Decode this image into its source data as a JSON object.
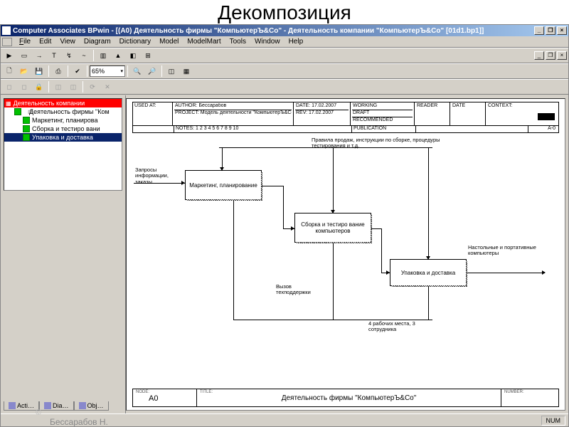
{
  "page_heading": "Декомпозиция",
  "titlebar": "Computer Associates BPwin - [(A0) Деятельность фирмы \"КомпьютерЪ&Co\" - Деятельность компании \"КомпьютерЪ&Co\"  [01d1.bp1]]",
  "menus": {
    "file": "File",
    "edit": "Edit",
    "view": "View",
    "diagram": "Diagram",
    "dictionary": "Dictionary",
    "model": "Model",
    "modelmart": "ModelMart",
    "tools": "Tools",
    "window": "Window",
    "help": "Help"
  },
  "zoom": "65%",
  "tree": {
    "root": "Деятельность компании",
    "items": [
      "Деятельность фирмы \"Ком",
      "Маркетинг, планирова",
      "Сборка и тестиро вани",
      "Упаковка и доставка"
    ],
    "selected_index": 3
  },
  "tabs": {
    "t1": "Acti…",
    "t2": "Dia…",
    "t3": "Obj…"
  },
  "header": {
    "used_at": "USED AT:",
    "author_lbl": "AUTHOR:",
    "author": "Бессарабов",
    "project_lbl": "PROJECT:",
    "project": "Модель деятельности \"КомпьютерЪ&Co\"",
    "date_lbl": "DATE:",
    "date": "17.02.2007",
    "rev_lbl": "REV:",
    "rev": "17.02.2007",
    "working": "WORKING",
    "draft": "DRAFT",
    "recommended": "RECOMMENDED",
    "publication": "PUBLICATION",
    "reader": "READER",
    "date2": "DATE",
    "context": "CONTEXT:",
    "notes_lbl": "NOTES:",
    "notes": "1  2  3  4  5  6  7  8  9  10",
    "a0_small": "A-0"
  },
  "footer": {
    "node_lbl": "NODE:",
    "node": "A0",
    "title_lbl": "TITLE:",
    "title": "Деятельность фирмы \"КомпьютерЪ&Co\"",
    "number_lbl": "NUMBER:"
  },
  "boxes": {
    "b1": "Маркетинг, планирование",
    "b2": "Сборка и тестиро вание компьютеров",
    "b3": "Упаковка и доставка"
  },
  "labels": {
    "top_rules": "Правила продаж, инструкции по сборке, процедуры тестирования и т.д.",
    "left_input": "Запросы информации, заказы",
    "bottom_support": "Вызов техподдержки",
    "right_output": "Настольные и портативные компьютеры",
    "bottom_staff": "4 рабочих места, 3 сотрудника"
  },
  "status": {
    "num": "NUM"
  },
  "credit_copy": "©",
  "credit": "Бессарабов Н."
}
